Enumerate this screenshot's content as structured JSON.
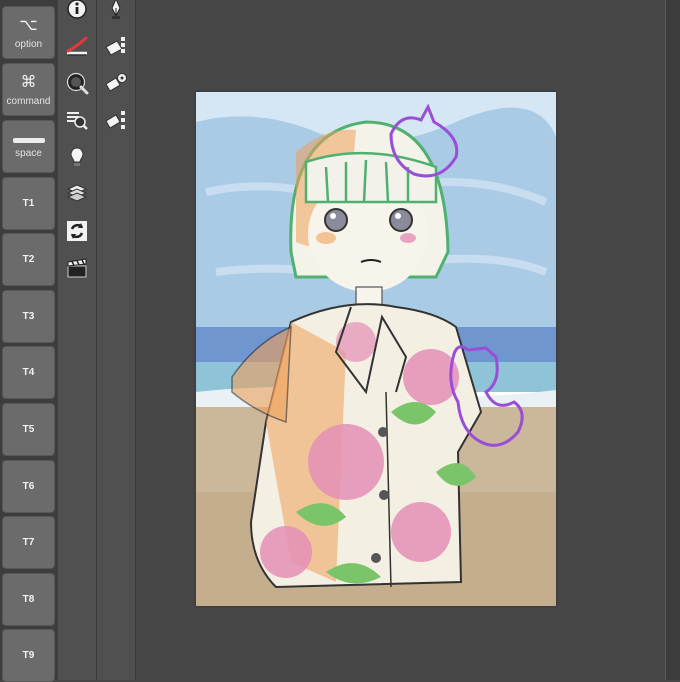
{
  "modifier_keys": [
    {
      "name": "option",
      "glyph": "⌥",
      "label": "option"
    },
    {
      "name": "command",
      "glyph": "⌘",
      "label": "command"
    },
    {
      "name": "space",
      "label": "space"
    }
  ],
  "tool_keys": [
    "T1",
    "T2",
    "T3",
    "T4",
    "T5",
    "T6",
    "T7",
    "T8",
    "T9"
  ],
  "tools_col1": [
    "info-icon",
    "brush-size-icon",
    "quick-access-icon",
    "search-layers-icon",
    "lightbulb-icon",
    "layers-icon",
    "sync-icon",
    "clapperboard-icon"
  ],
  "tools_col2": [
    "pen-nib-icon",
    "auto-action-1-icon",
    "auto-action-2-icon",
    "auto-action-3-icon"
  ],
  "colors": {
    "workspace": "#474747",
    "panel": "#505050",
    "key": "#6b6b6b",
    "sky": "#a9cbe6",
    "sea": "#6f96cf",
    "sand": "#cbb79a",
    "line_green": "#4fb070",
    "pink": "#e48fb5",
    "orange": "#efa15a",
    "purple": "#9a4ed8"
  }
}
